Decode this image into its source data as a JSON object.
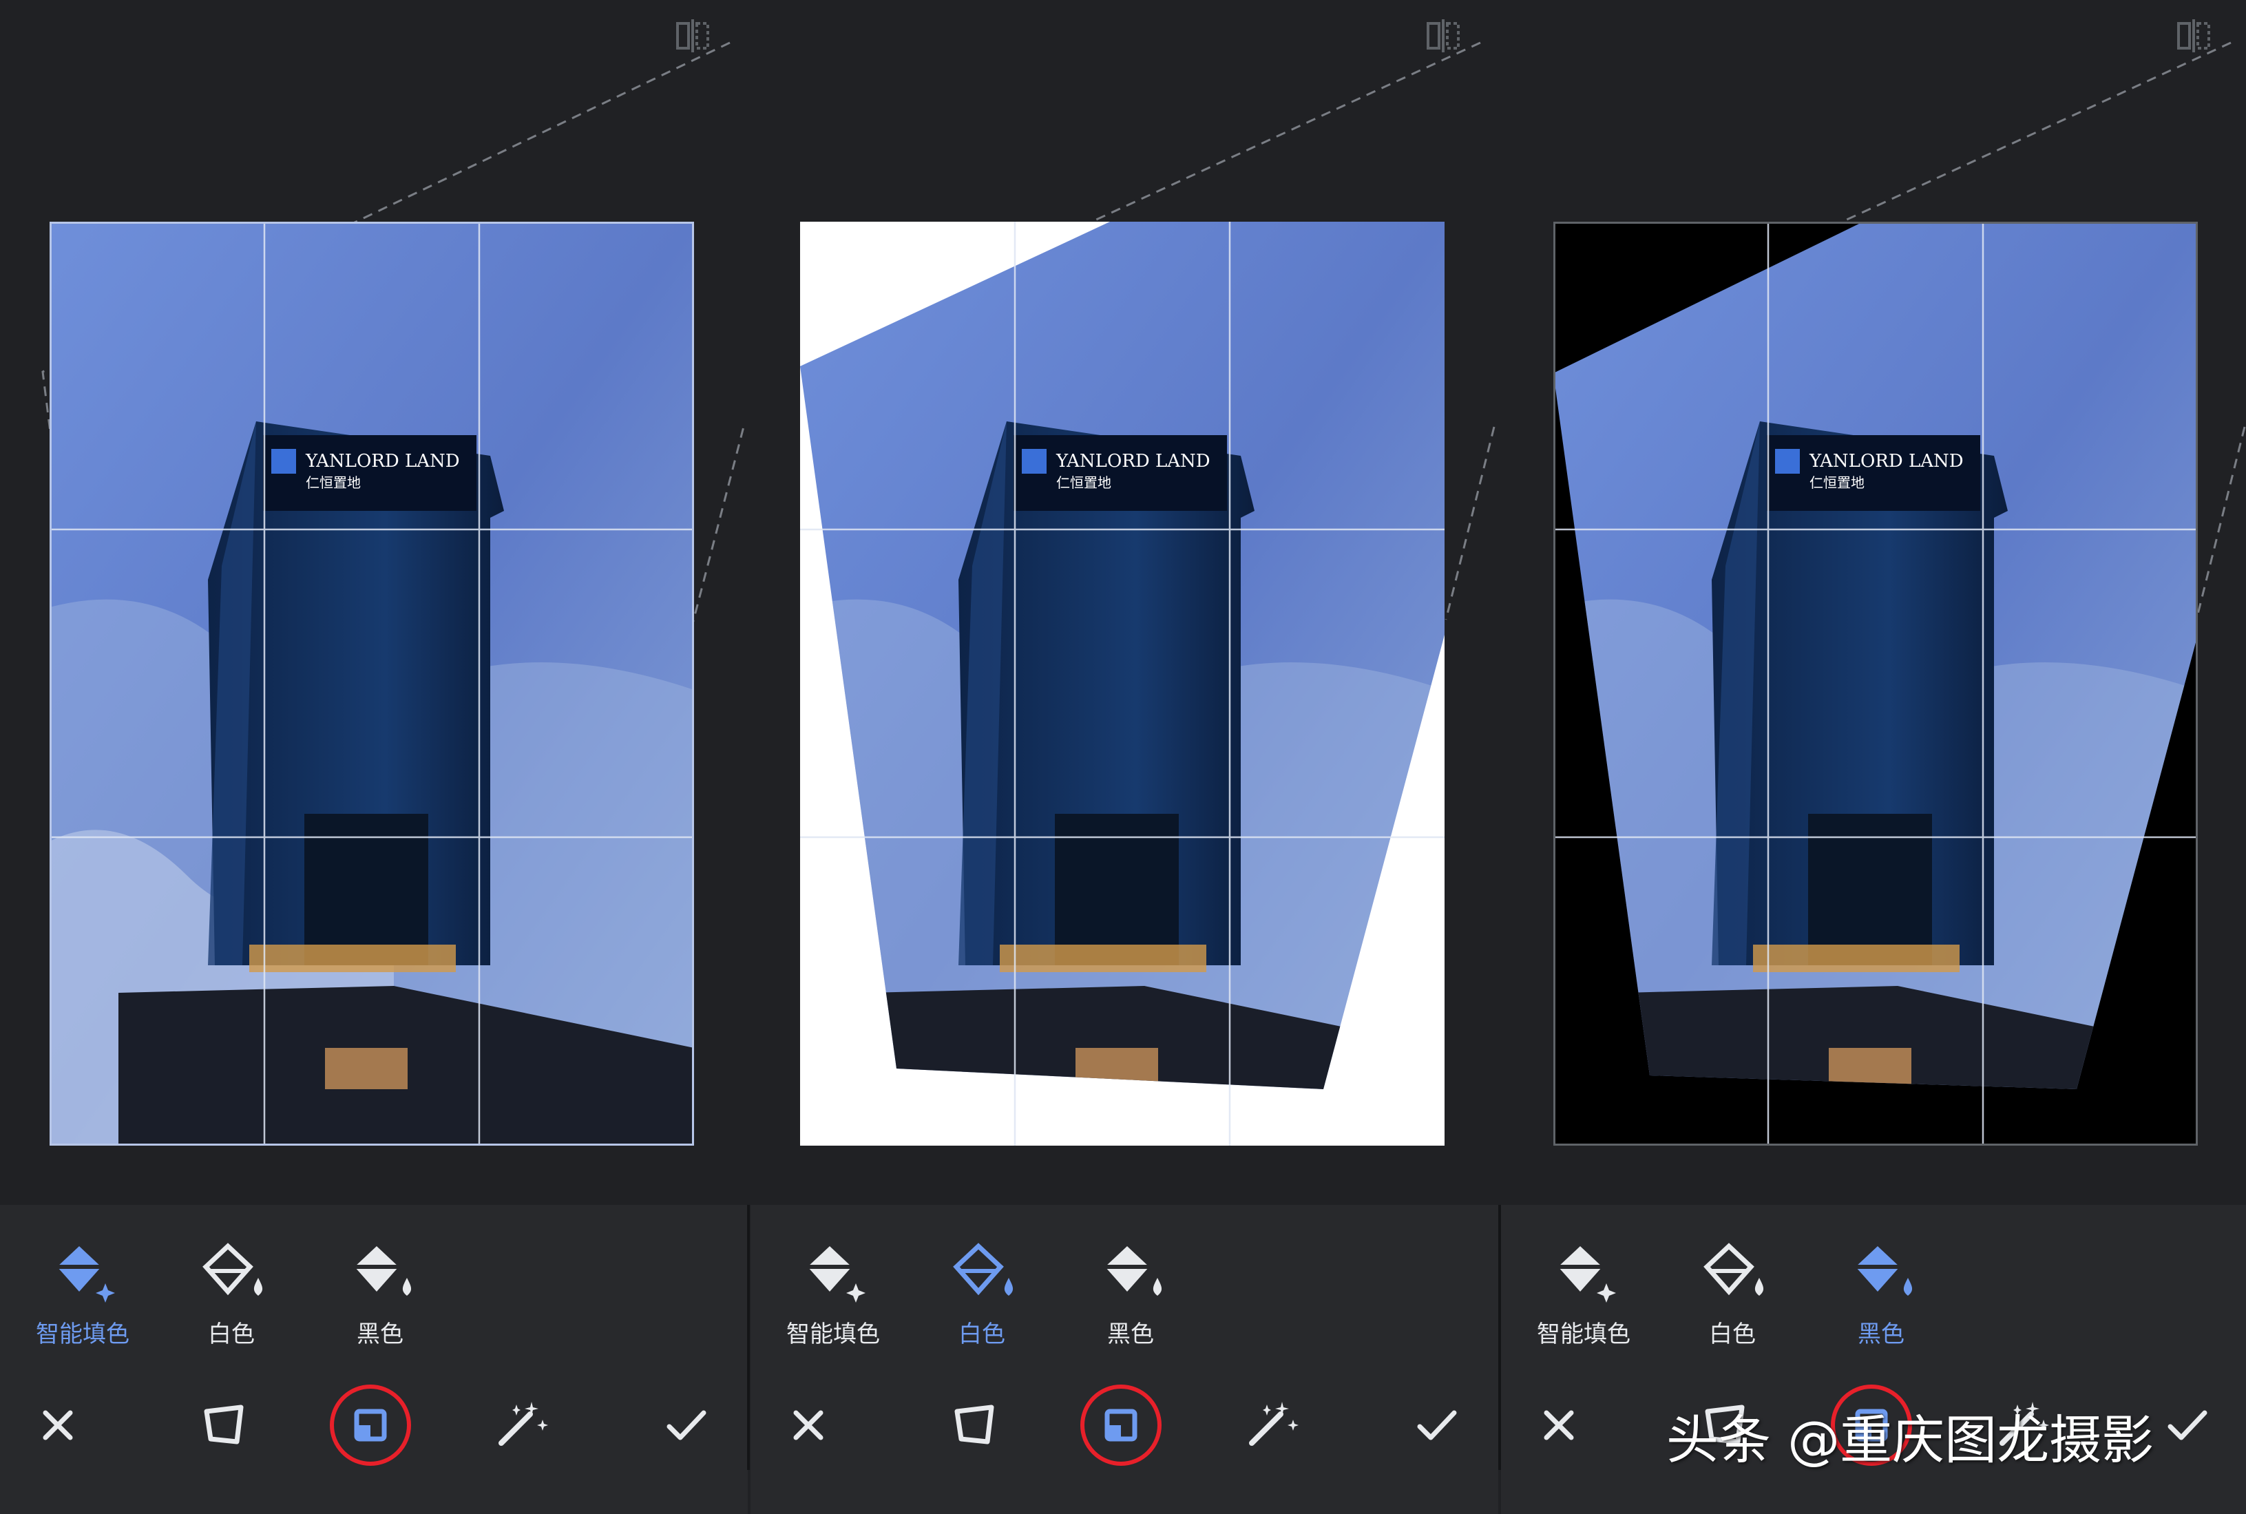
{
  "panels": [
    {
      "fill_mode": "smart",
      "fill_options": [
        {
          "label": "智能填色",
          "icon": "bucket-sparkle-icon",
          "active": true
        },
        {
          "label": "白色",
          "icon": "bucket-outline-drop-icon",
          "active": false
        },
        {
          "label": "黑色",
          "icon": "bucket-drop-icon",
          "active": false
        }
      ],
      "tools": [
        "close-icon",
        "perspective-icon",
        "fill-icon",
        "auto-magic-icon",
        "check-icon"
      ]
    },
    {
      "fill_mode": "white",
      "fill_options": [
        {
          "label": "智能填色",
          "icon": "bucket-sparkle-icon",
          "active": false
        },
        {
          "label": "白色",
          "icon": "bucket-outline-drop-icon",
          "active": true
        },
        {
          "label": "黑色",
          "icon": "bucket-drop-icon",
          "active": false
        }
      ],
      "tools": [
        "close-icon",
        "perspective-icon",
        "fill-icon",
        "auto-magic-icon",
        "check-icon"
      ]
    },
    {
      "fill_mode": "black",
      "fill_options": [
        {
          "label": "智能填色",
          "icon": "bucket-sparkle-icon",
          "active": false
        },
        {
          "label": "白色",
          "icon": "bucket-outline-drop-icon",
          "active": false
        },
        {
          "label": "黑色",
          "icon": "bucket-drop-icon",
          "active": true
        }
      ],
      "tools": [
        "close-icon",
        "perspective-icon",
        "fill-icon",
        "auto-magic-icon",
        "check-icon"
      ]
    }
  ],
  "building_sign": {
    "line1": "YANLORD LAND",
    "line2": "仁恒置地"
  },
  "watermark": "头条 @重庆图龙摄影",
  "colors": {
    "background": "#202124",
    "toolbar": "#28292c",
    "accent": "#6e9bf0",
    "label": "#e8eaed",
    "highlight_ring": "#e8202a"
  }
}
